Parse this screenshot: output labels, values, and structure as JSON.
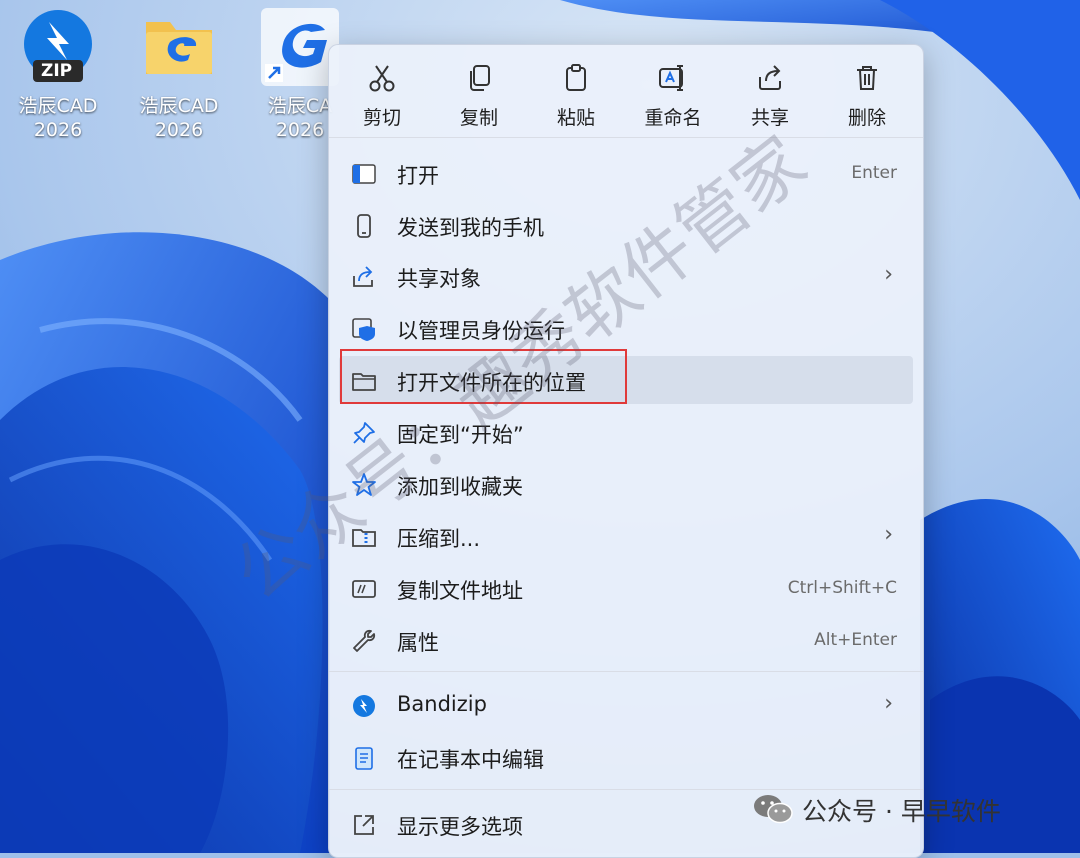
{
  "desktop": {
    "icons": [
      {
        "label_line1": "浩辰CAD",
        "label_line2": "2026",
        "badge": "ZIP"
      },
      {
        "label_line1": "浩辰CAD",
        "label_line2": "2026"
      },
      {
        "label_line1": "浩辰CA",
        "label_line2": "2026"
      }
    ]
  },
  "menu": {
    "quick_actions": [
      {
        "label": "剪切",
        "icon": "cut-icon"
      },
      {
        "label": "复制",
        "icon": "copy-icon"
      },
      {
        "label": "粘贴",
        "icon": "paste-icon"
      },
      {
        "label": "重命名",
        "icon": "rename-icon"
      },
      {
        "label": "共享",
        "icon": "share-icon"
      },
      {
        "label": "删除",
        "icon": "delete-icon"
      }
    ],
    "items": [
      {
        "label": "打开",
        "shortcut": "Enter",
        "icon": "open-icon"
      },
      {
        "label": "发送到我的手机",
        "icon": "phone-icon"
      },
      {
        "label": "共享对象",
        "submenu": true,
        "icon": "share-icon"
      },
      {
        "label": "以管理员身份运行",
        "icon": "shield-icon"
      },
      {
        "label": "打开文件所在的位置",
        "icon": "folder-icon",
        "highlighted": true
      },
      {
        "label": "固定到“开始”",
        "icon": "pin-icon"
      },
      {
        "label": "添加到收藏夹",
        "icon": "star-icon"
      },
      {
        "label": "压缩到...",
        "submenu": true,
        "icon": "zip-folder-icon"
      },
      {
        "label": "复制文件地址",
        "shortcut": "Ctrl+Shift+C",
        "icon": "copy-path-icon"
      },
      {
        "label": "属性",
        "shortcut": "Alt+Enter",
        "icon": "wrench-icon"
      }
    ],
    "items2": [
      {
        "label": "Bandizip",
        "submenu": true,
        "icon": "bandizip-icon"
      },
      {
        "label": "在记事本中编辑",
        "icon": "notepad-icon"
      }
    ],
    "more": {
      "label": "显示更多选项",
      "icon": "more-options-icon"
    },
    "arrow_glyph": "›"
  },
  "watermark": {
    "text": "公众号：趣秀软件管家"
  },
  "wechat_badge": {
    "text": "公众号 · 早早软件"
  },
  "colors": {
    "accent": "#0067c0",
    "highlight_box": "#e03a3a"
  }
}
